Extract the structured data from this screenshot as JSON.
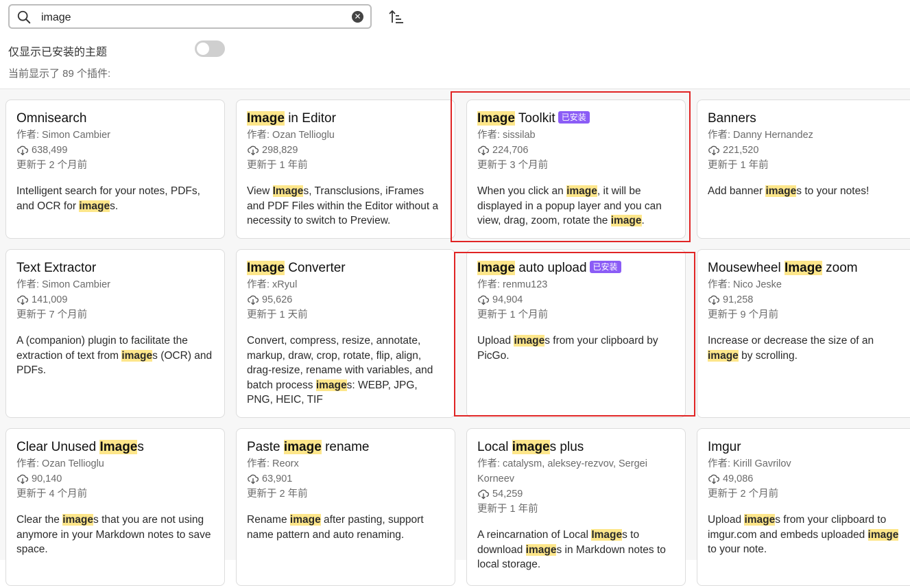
{
  "search": {
    "value": "image",
    "clear_glyph": "✕"
  },
  "filter": {
    "installed_only_label": "仅显示已安装的主题",
    "installed_only_on": false
  },
  "result_count": "当前显示了 89 个插件:",
  "installed_badge": "已安装",
  "highlight_color": "#fde68a",
  "badge_color": "#8b5cf6",
  "outline_color": "#e02424",
  "plugins": [
    {
      "title_pre": "Omnisearch",
      "title_hl": "",
      "title_post": "",
      "installed": false,
      "author": "作者:  Simon Cambier",
      "downloads": "638,499",
      "updated": "更新于 2 个月前",
      "desc": [
        {
          "t": "Intelligent search for your notes, PDFs, and OCR for "
        },
        {
          "h": "image"
        },
        {
          "t": "s."
        }
      ]
    },
    {
      "title_pre": "",
      "title_hl": "Image",
      "title_post": " in Editor",
      "installed": false,
      "author": "作者:  Ozan Tellioglu",
      "downloads": "298,829",
      "updated": "更新于 1 年前",
      "desc": [
        {
          "t": "View "
        },
        {
          "h": "Image"
        },
        {
          "t": "s, Transclusions, iFrames and PDF Files within the Editor without a necessity to switch to Preview."
        }
      ]
    },
    {
      "title_pre": "",
      "title_hl": "Image",
      "title_post": " Toolkit",
      "installed": true,
      "author": "作者:  sissilab",
      "downloads": "224,706",
      "updated": "更新于 3 个月前",
      "desc": [
        {
          "t": "When you click an "
        },
        {
          "h": "image"
        },
        {
          "t": ", it will be displayed in a popup layer and you can view, drag, zoom, rotate the "
        },
        {
          "h": "image"
        },
        {
          "t": "."
        }
      ]
    },
    {
      "title_pre": "Banners",
      "title_hl": "",
      "title_post": "",
      "installed": false,
      "author": "作者:  Danny Hernandez",
      "downloads": "221,520",
      "updated": "更新于 1 年前",
      "desc": [
        {
          "t": "Add banner "
        },
        {
          "h": "image"
        },
        {
          "t": "s to your notes!"
        }
      ]
    },
    {
      "title_pre": "Text Extractor",
      "title_hl": "",
      "title_post": "",
      "installed": false,
      "author": "作者:  Simon Cambier",
      "downloads": "141,009",
      "updated": "更新于 7 个月前",
      "desc": [
        {
          "t": "A (companion) plugin to facilitate the extraction of text from "
        },
        {
          "h": "image"
        },
        {
          "t": "s (OCR) and PDFs."
        }
      ]
    },
    {
      "title_pre": "",
      "title_hl": "Image",
      "title_post": " Converter",
      "installed": false,
      "author": "作者:  xRyul",
      "downloads": "95,626",
      "updated": "更新于 1 天前",
      "desc": [
        {
          "t": "Convert, compress, resize, annotate, markup, draw, crop, rotate, flip, align, drag-resize, rename with variables, and batch process "
        },
        {
          "h": "image"
        },
        {
          "t": "s: WEBP, JPG, PNG, HEIC, TIF"
        }
      ]
    },
    {
      "title_pre": "",
      "title_hl": "Image",
      "title_post": " auto upload",
      "installed": true,
      "author": "作者:  renmu123",
      "downloads": "94,904",
      "updated": "更新于 1 个月前",
      "desc": [
        {
          "t": "Upload "
        },
        {
          "h": "image"
        },
        {
          "t": "s from your clipboard by PicGo."
        }
      ]
    },
    {
      "title_pre": "Mousewheel ",
      "title_hl": "Image",
      "title_post": " zoom",
      "installed": false,
      "author": "作者:  Nico Jeske",
      "downloads": "91,258",
      "updated": "更新于 9 个月前",
      "desc": [
        {
          "t": "Increase or decrease the size of an "
        },
        {
          "h": "image"
        },
        {
          "t": " by scrolling."
        }
      ]
    },
    {
      "title_pre": "Clear Unused ",
      "title_hl": "Image",
      "title_post": "s",
      "installed": false,
      "author": "作者:  Ozan Tellioglu",
      "downloads": "90,140",
      "updated": "更新于 4 个月前",
      "desc": [
        {
          "t": "Clear the "
        },
        {
          "h": "image"
        },
        {
          "t": "s that you are not using anymore in your Markdown notes to save space."
        }
      ]
    },
    {
      "title_pre": "Paste ",
      "title_hl": "image",
      "title_post": " rename",
      "installed": false,
      "author": "作者:  Reorx",
      "downloads": "63,901",
      "updated": "更新于 2 年前",
      "desc": [
        {
          "t": "Rename "
        },
        {
          "h": "image"
        },
        {
          "t": " after pasting, support name pattern and auto renaming."
        }
      ]
    },
    {
      "title_pre": "Local ",
      "title_hl": "image",
      "title_post": "s plus",
      "installed": false,
      "author": "作者:  catalysm, aleksey-rezvov, Sergei Korneev",
      "downloads": "54,259",
      "updated": "更新于 1 年前",
      "desc": [
        {
          "t": "A reincarnation of Local "
        },
        {
          "h": "Image"
        },
        {
          "t": "s to download "
        },
        {
          "h": "image"
        },
        {
          "t": "s in Markdown notes to local storage."
        }
      ]
    },
    {
      "title_pre": "Imgur",
      "title_hl": "",
      "title_post": "",
      "installed": false,
      "author": "作者:  Kirill Gavrilov",
      "downloads": "49,086",
      "updated": "更新于 2 个月前",
      "desc": [
        {
          "t": "Upload "
        },
        {
          "h": "image"
        },
        {
          "t": "s from your clipboard to imgur.com and embeds uploaded "
        },
        {
          "h": "image"
        },
        {
          "t": " to your note."
        }
      ]
    }
  ]
}
